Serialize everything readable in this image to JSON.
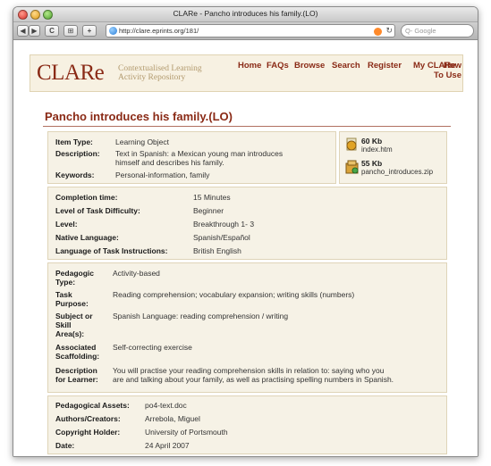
{
  "window": {
    "title": "CLARe - Pancho introduces his family.(LO)"
  },
  "toolbar": {
    "back": "◀",
    "forward": "▶",
    "reload": "C",
    "bookmark": "⊞",
    "add": "+",
    "url": "http://clare.eprints.org/181/",
    "search_placeholder": "Q- Google"
  },
  "header": {
    "logo": "CLARe",
    "logo_sub_1": "Contextualised Learning",
    "logo_sub_2": "Activity Repository"
  },
  "nav": {
    "home": "Home",
    "faqs": "FAQs",
    "browse": "Browse",
    "search": "Search",
    "register": "Register",
    "myclare": "My CLARe",
    "howto_1": "How",
    "howto_2": "To Use"
  },
  "page_title": "Pancho introduces his family.(LO)",
  "info": {
    "item_type_label": "Item Type:",
    "item_type": "Learning Object",
    "description_label": "Description:",
    "description_1": "Text in Spanish: a Mexican young man introduces",
    "description_2": "himself and describes his family.",
    "keywords_label": "Keywords:",
    "keywords": "Personal-information, family"
  },
  "files": [
    {
      "size": "60 Kb",
      "name": "index.htm"
    },
    {
      "size": "55 Kb",
      "name": "pancho_introduces.zip"
    }
  ],
  "details": {
    "completion_label": "Completion time:",
    "completion": "15 Minutes",
    "difficulty_label": "Level of Task Difficulty:",
    "difficulty": "Beginner",
    "level_label": "Level:",
    "level": "Breakthrough 1- 3",
    "native_label": "Native Language:",
    "native": "Spanish/Español",
    "instructions_label": "Language of Task Instructions:",
    "instructions": "British English"
  },
  "pedagogy": {
    "ped_type_label_1": "Pedagogic",
    "ped_type_label_2": "Type:",
    "ped_type": "Activity-based",
    "purpose_label_1": "Task",
    "purpose_label_2": "Purpose:",
    "purpose": "Reading comprehension; vocabulary expansion; writing skills (numbers)",
    "subject_label_1": "Subject or",
    "subject_label_2": "Skill",
    "subject_label_3": "Area(s):",
    "subject": "Spanish Language: reading comprehension / writing",
    "scaffold_label_1": "Associated",
    "scaffold_label_2": "Scaffolding:",
    "scaffold": "Self-correcting exercise",
    "learner_label_1": "Description",
    "learner_label_2": "for Learner:",
    "learner_1": "You will practise your reading comprehension skills in relation to: saying who you",
    "learner_2": "are and talking about your family, as well as practising spelling numbers in Spanish."
  },
  "assets": {
    "assets_label": "Pedagogical Assets:",
    "assets": "po4-text.doc",
    "authors_label": "Authors/Creators:",
    "authors": "Arrebola, Miguel",
    "copyright_label": "Copyright Holder:",
    "copyright": "University of Portsmouth",
    "date_label": "Date:",
    "date": "24 April 2007"
  },
  "colors": {
    "accent": "#8a2a16",
    "panel": "#f6f2e6",
    "header_bg": "#f7f1e2"
  }
}
